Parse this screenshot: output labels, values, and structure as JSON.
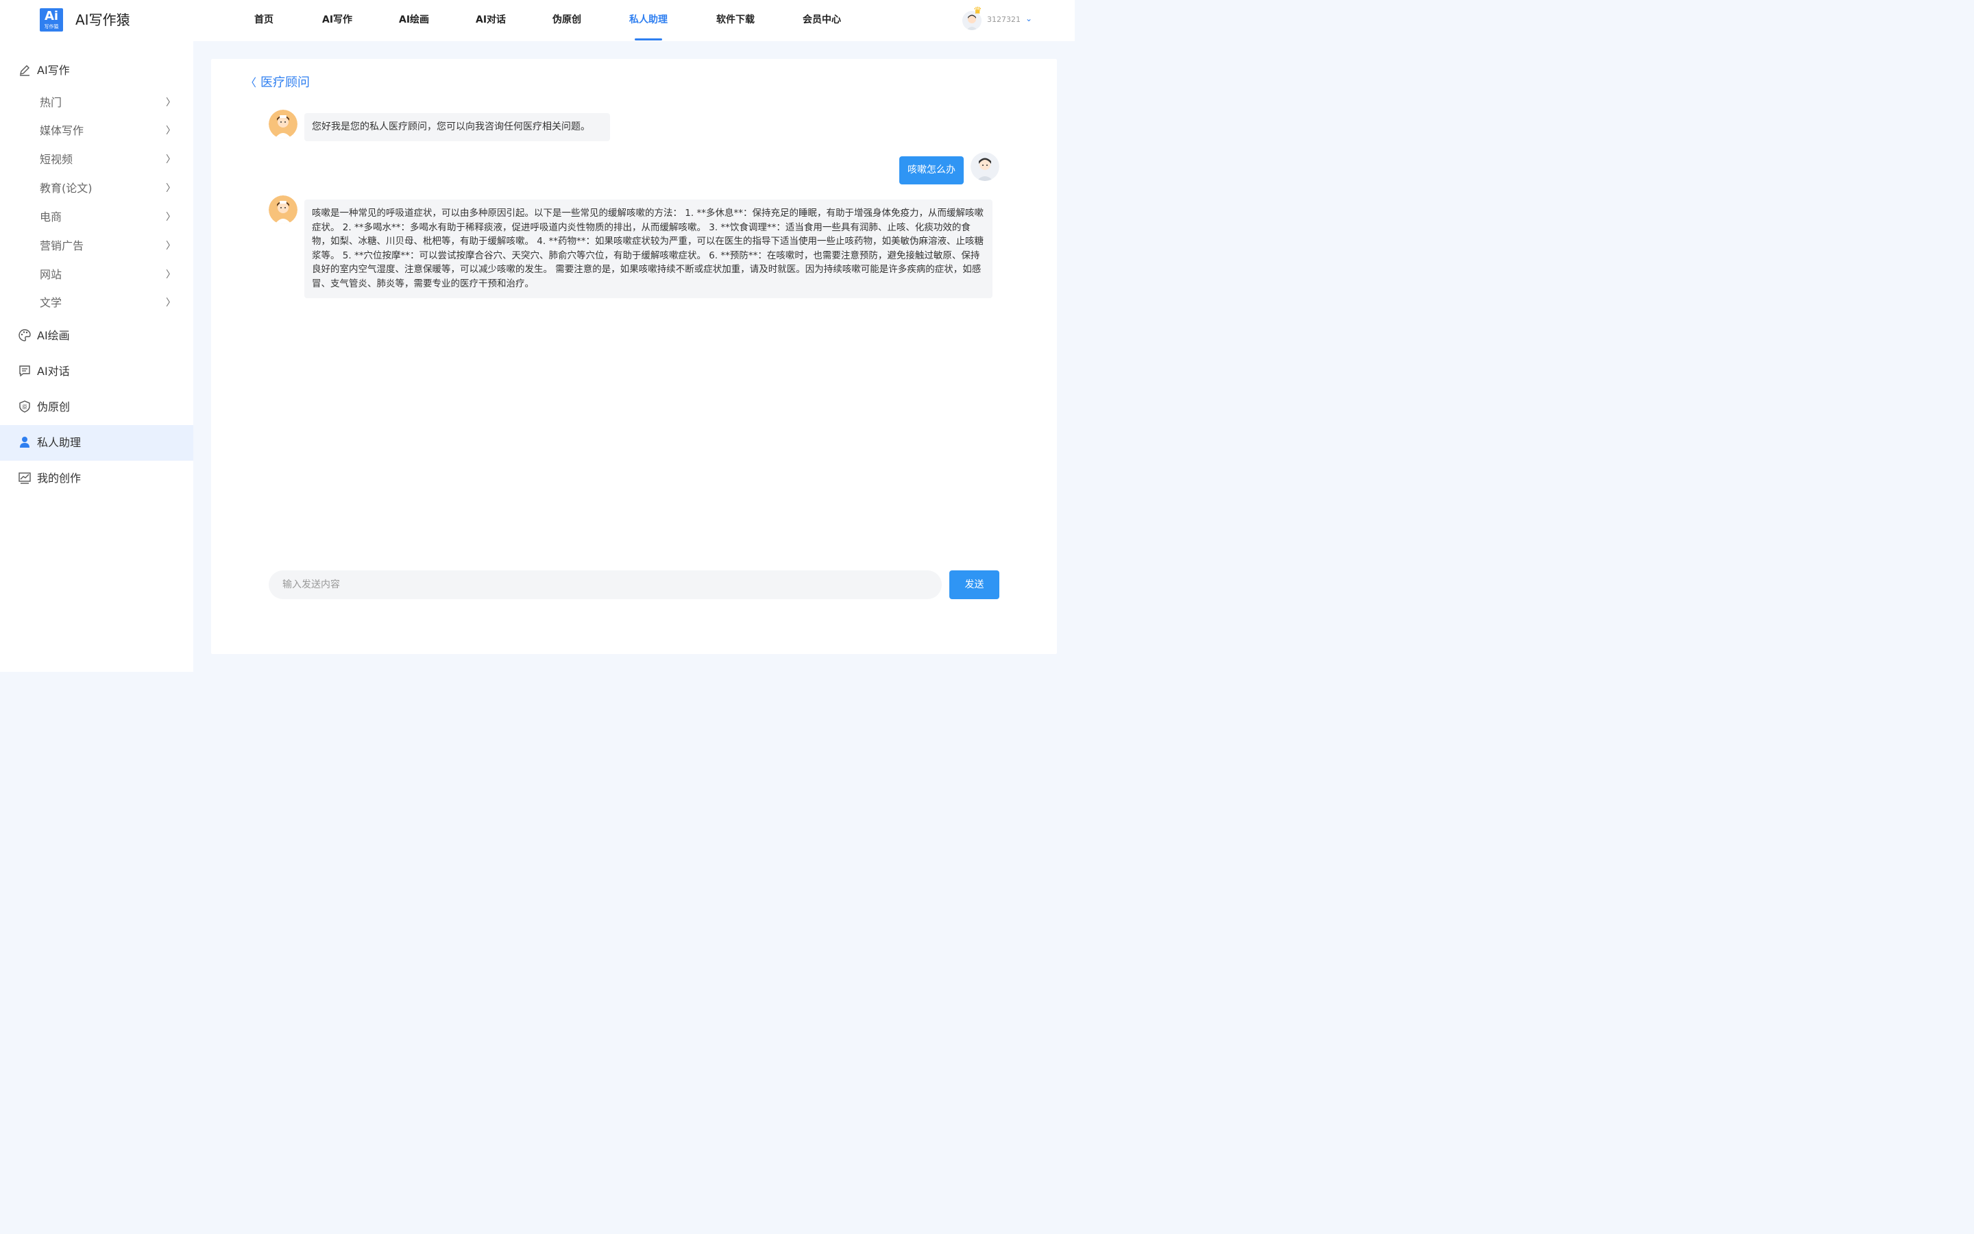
{
  "brand": {
    "logo_text": "Ai",
    "logo_sub": "写作猿",
    "name": "AI写作猿"
  },
  "nav": {
    "items": [
      "首页",
      "AI写作",
      "AI绘画",
      "AI对话",
      "伪原创",
      "私人助理",
      "软件下载",
      "会员中心"
    ],
    "active": "私人助理"
  },
  "user": {
    "id": "3127321"
  },
  "sidebar": {
    "writing_label": "AI写作",
    "writing_items": [
      "热门",
      "媒体写作",
      "短视频",
      "教育(论文)",
      "电商",
      "营销广告",
      "网站",
      "文学"
    ],
    "painting_label": "AI绘画",
    "chat_label": "AI对话",
    "pseudo_label": "伪原创",
    "assistant_label": "私人助理",
    "creations_label": "我的创作"
  },
  "chat": {
    "title": "医疗顾问",
    "messages": [
      {
        "role": "bot",
        "text": "您好我是您的私人医疗顾问，您可以向我咨询任何医疗相关问题。"
      },
      {
        "role": "user",
        "text": "咳嗽怎么办"
      },
      {
        "role": "bot",
        "text": "咳嗽是一种常见的呼吸道症状，可以由多种原因引起。以下是一些常见的缓解咳嗽的方法： 1. **多休息**：保持充足的睡眠，有助于增强身体免疫力，从而缓解咳嗽症状。 2. **多喝水**：多喝水有助于稀释痰液，促进呼吸道内炎性物质的排出，从而缓解咳嗽。 3. **饮食调理**：适当食用一些具有润肺、止咳、化痰功效的食物，如梨、冰糖、川贝母、枇杷等，有助于缓解咳嗽。 4. **药物**：如果咳嗽症状较为严重，可以在医生的指导下适当使用一些止咳药物，如美敏伪麻溶液、止咳糖浆等。 5. **穴位按摩**：可以尝试按摩合谷穴、天突穴、肺俞穴等穴位，有助于缓解咳嗽症状。 6. **预防**：在咳嗽时，也需要注意预防，避免接触过敏原、保持良好的室内空气湿度、注意保暖等，可以减少咳嗽的发生。 需要注意的是，如果咳嗽持续不断或症状加重，请及时就医。因为持续咳嗽可能是许多疾病的症状，如感冒、支气管炎、肺炎等，需要专业的医疗干预和治疗。"
      }
    ],
    "input_placeholder": "输入发送内容",
    "send_label": "发送"
  },
  "colors": {
    "accent": "#2f7ff0",
    "send": "#2f95f4",
    "active_bg": "#e9f1fe"
  }
}
